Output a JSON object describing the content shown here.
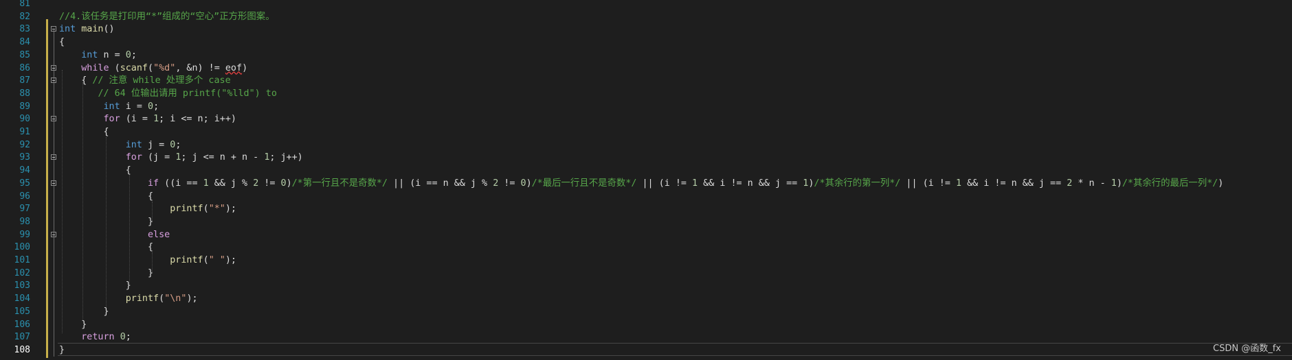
{
  "editor": {
    "lines": [
      {
        "n": "81",
        "fold": false,
        "tokens": []
      },
      {
        "n": "82",
        "fold": false,
        "tokens": [
          {
            "t": "//4.该任务是打印用“*”组成的“空心”正方形图案。",
            "c": "cmt"
          }
        ]
      },
      {
        "n": "83",
        "fold": true,
        "tokens": [
          {
            "t": "int",
            "c": "kw"
          },
          {
            "t": " ",
            "c": "plain"
          },
          {
            "t": "main",
            "c": "fn"
          },
          {
            "t": "()",
            "c": "plain"
          }
        ]
      },
      {
        "n": "84",
        "fold": false,
        "tokens": [
          {
            "t": "{",
            "c": "plain"
          }
        ]
      },
      {
        "n": "85",
        "fold": false,
        "tokens": [
          {
            "t": "    ",
            "c": "plain"
          },
          {
            "t": "int",
            "c": "kw"
          },
          {
            "t": " n = ",
            "c": "plain"
          },
          {
            "t": "0",
            "c": "num"
          },
          {
            "t": ";",
            "c": "plain"
          }
        ]
      },
      {
        "n": "86",
        "fold": true,
        "tokens": [
          {
            "t": "    ",
            "c": "plain"
          },
          {
            "t": "while",
            "c": "ctl"
          },
          {
            "t": " (",
            "c": "plain"
          },
          {
            "t": "scanf",
            "c": "fn"
          },
          {
            "t": "(",
            "c": "plain"
          },
          {
            "t": "\"%d\"",
            "c": "str"
          },
          {
            "t": ", &n) != ",
            "c": "plain"
          },
          {
            "t": "eof",
            "c": "squig"
          },
          {
            "t": ")",
            "c": "plain"
          }
        ]
      },
      {
        "n": "87",
        "fold": true,
        "tokens": [
          {
            "t": "    { ",
            "c": "plain"
          },
          {
            "t": "// 注意 while 处理多个 case",
            "c": "cmt"
          }
        ]
      },
      {
        "n": "88",
        "fold": false,
        "tokens": [
          {
            "t": "       ",
            "c": "plain"
          },
          {
            "t": "// 64 位输出请用 printf(\"%lld\") to",
            "c": "cmt"
          }
        ]
      },
      {
        "n": "89",
        "fold": false,
        "tokens": [
          {
            "t": "        ",
            "c": "plain"
          },
          {
            "t": "int",
            "c": "kw"
          },
          {
            "t": " i = ",
            "c": "plain"
          },
          {
            "t": "0",
            "c": "num"
          },
          {
            "t": ";",
            "c": "plain"
          }
        ]
      },
      {
        "n": "90",
        "fold": true,
        "tokens": [
          {
            "t": "        ",
            "c": "plain"
          },
          {
            "t": "for",
            "c": "ctl"
          },
          {
            "t": " (i = ",
            "c": "plain"
          },
          {
            "t": "1",
            "c": "num"
          },
          {
            "t": "; i <= n; i++)",
            "c": "plain"
          }
        ]
      },
      {
        "n": "91",
        "fold": false,
        "tokens": [
          {
            "t": "        {",
            "c": "plain"
          }
        ]
      },
      {
        "n": "92",
        "fold": false,
        "tokens": [
          {
            "t": "            ",
            "c": "plain"
          },
          {
            "t": "int",
            "c": "kw"
          },
          {
            "t": " j = ",
            "c": "plain"
          },
          {
            "t": "0",
            "c": "num"
          },
          {
            "t": ";",
            "c": "plain"
          }
        ]
      },
      {
        "n": "93",
        "fold": true,
        "tokens": [
          {
            "t": "            ",
            "c": "plain"
          },
          {
            "t": "for",
            "c": "ctl"
          },
          {
            "t": " (j = ",
            "c": "plain"
          },
          {
            "t": "1",
            "c": "num"
          },
          {
            "t": "; j <= n + n - ",
            "c": "plain"
          },
          {
            "t": "1",
            "c": "num"
          },
          {
            "t": "; j++)",
            "c": "plain"
          }
        ]
      },
      {
        "n": "94",
        "fold": false,
        "tokens": [
          {
            "t": "            {",
            "c": "plain"
          }
        ]
      },
      {
        "n": "95",
        "fold": true,
        "tokens": [
          {
            "t": "                ",
            "c": "plain"
          },
          {
            "t": "if",
            "c": "ctl"
          },
          {
            "t": " ((i == ",
            "c": "plain"
          },
          {
            "t": "1",
            "c": "num"
          },
          {
            "t": " && j % ",
            "c": "plain"
          },
          {
            "t": "2",
            "c": "num"
          },
          {
            "t": " != ",
            "c": "plain"
          },
          {
            "t": "0",
            "c": "num"
          },
          {
            "t": ")",
            "c": "plain"
          },
          {
            "t": "/*第一行且不是奇数*/",
            "c": "cmt"
          },
          {
            "t": " || (i == n && j % ",
            "c": "plain"
          },
          {
            "t": "2",
            "c": "num"
          },
          {
            "t": " != ",
            "c": "plain"
          },
          {
            "t": "0",
            "c": "num"
          },
          {
            "t": ")",
            "c": "plain"
          },
          {
            "t": "/*最后一行且不是奇数*/",
            "c": "cmt"
          },
          {
            "t": " || (i != ",
            "c": "plain"
          },
          {
            "t": "1",
            "c": "num"
          },
          {
            "t": " && i != n && j == ",
            "c": "plain"
          },
          {
            "t": "1",
            "c": "num"
          },
          {
            "t": ")",
            "c": "plain"
          },
          {
            "t": "/*其余行的第一列*/",
            "c": "cmt"
          },
          {
            "t": " || (i != ",
            "c": "plain"
          },
          {
            "t": "1",
            "c": "num"
          },
          {
            "t": " && i != n && j == ",
            "c": "plain"
          },
          {
            "t": "2",
            "c": "num"
          },
          {
            "t": " * n - ",
            "c": "plain"
          },
          {
            "t": "1",
            "c": "num"
          },
          {
            "t": ")",
            "c": "plain"
          },
          {
            "t": "/*其余行的最后一列*/",
            "c": "cmt"
          },
          {
            "t": ")",
            "c": "plain"
          }
        ]
      },
      {
        "n": "96",
        "fold": false,
        "tokens": [
          {
            "t": "                {",
            "c": "plain"
          }
        ]
      },
      {
        "n": "97",
        "fold": false,
        "tokens": [
          {
            "t": "                    ",
            "c": "plain"
          },
          {
            "t": "printf",
            "c": "fn"
          },
          {
            "t": "(",
            "c": "plain"
          },
          {
            "t": "\"*\"",
            "c": "str"
          },
          {
            "t": ");",
            "c": "plain"
          }
        ]
      },
      {
        "n": "98",
        "fold": false,
        "tokens": [
          {
            "t": "                }",
            "c": "plain"
          }
        ]
      },
      {
        "n": "99",
        "fold": true,
        "tokens": [
          {
            "t": "                ",
            "c": "plain"
          },
          {
            "t": "else",
            "c": "ctl"
          }
        ]
      },
      {
        "n": "100",
        "fold": false,
        "tokens": [
          {
            "t": "                {",
            "c": "plain"
          }
        ]
      },
      {
        "n": "101",
        "fold": false,
        "tokens": [
          {
            "t": "                    ",
            "c": "plain"
          },
          {
            "t": "printf",
            "c": "fn"
          },
          {
            "t": "(",
            "c": "plain"
          },
          {
            "t": "\" \"",
            "c": "str"
          },
          {
            "t": ");",
            "c": "plain"
          }
        ]
      },
      {
        "n": "102",
        "fold": false,
        "tokens": [
          {
            "t": "                }",
            "c": "plain"
          }
        ]
      },
      {
        "n": "103",
        "fold": false,
        "tokens": [
          {
            "t": "            }",
            "c": "plain"
          }
        ]
      },
      {
        "n": "104",
        "fold": false,
        "tokens": [
          {
            "t": "            ",
            "c": "plain"
          },
          {
            "t": "printf",
            "c": "fn"
          },
          {
            "t": "(",
            "c": "plain"
          },
          {
            "t": "\"\\n\"",
            "c": "str"
          },
          {
            "t": ");",
            "c": "plain"
          }
        ]
      },
      {
        "n": "105",
        "fold": false,
        "tokens": [
          {
            "t": "        }",
            "c": "plain"
          }
        ]
      },
      {
        "n": "106",
        "fold": false,
        "tokens": [
          {
            "t": "    }",
            "c": "plain"
          }
        ]
      },
      {
        "n": "107",
        "fold": false,
        "tokens": [
          {
            "t": "    ",
            "c": "plain"
          },
          {
            "t": "return",
            "c": "ctl"
          },
          {
            "t": " ",
            "c": "plain"
          },
          {
            "t": "0",
            "c": "num"
          },
          {
            "t": ";",
            "c": "plain"
          }
        ]
      },
      {
        "n": "108",
        "fold": false,
        "tokens": [
          {
            "t": "}",
            "c": "plain"
          }
        ]
      }
    ],
    "current_line": "108"
  },
  "watermark": "CSDN @函数_fx",
  "colors": {
    "background": "#1e1e1e",
    "line_number": "#2b91af",
    "keyword": "#569cd6",
    "control_keyword": "#d8a0df",
    "function": "#dcdcaa",
    "string": "#d69d85",
    "comment": "#57a64a",
    "number": "#b5cea8",
    "change_margin": "#c8b04a"
  }
}
